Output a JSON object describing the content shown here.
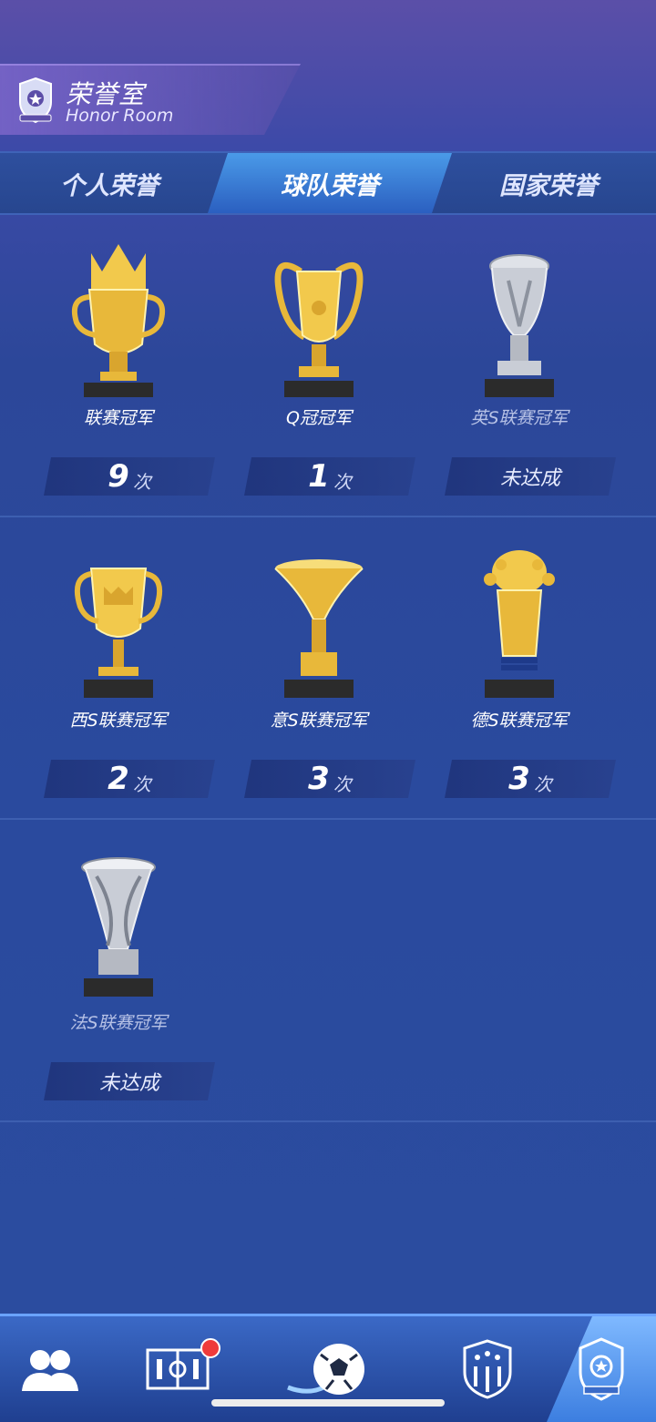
{
  "header": {
    "title_cn": "荣誉室",
    "title_en": "Honor Room"
  },
  "tabs": [
    {
      "label": "个人荣誉",
      "active": false
    },
    {
      "label": "球队荣誉",
      "active": true
    },
    {
      "label": "国家荣誉",
      "active": false
    }
  ],
  "trophies": [
    {
      "name": "联赛冠军",
      "count": "9",
      "unit": "次",
      "achieved": true,
      "color": "#e8b83a"
    },
    {
      "name": "Q冠冠军",
      "count": "1",
      "unit": "次",
      "achieved": true,
      "color": "#e8b83a"
    },
    {
      "name": "英S联赛冠军",
      "status": "未达成",
      "achieved": false,
      "color": "#c9cdd6"
    },
    {
      "name": "西S联赛冠军",
      "count": "2",
      "unit": "次",
      "achieved": true,
      "color": "#e8b83a"
    },
    {
      "name": "意S联赛冠军",
      "count": "3",
      "unit": "次",
      "achieved": true,
      "color": "#e8b83a"
    },
    {
      "name": "德S联赛冠军",
      "count": "3",
      "unit": "次",
      "achieved": true,
      "color": "#e8b83a"
    },
    {
      "name": "法S联赛冠军",
      "status": "未达成",
      "achieved": false,
      "color": "#c9cdd6"
    }
  ],
  "nav": [
    {
      "icon": "team-icon"
    },
    {
      "icon": "formation-icon",
      "badge": true
    },
    {
      "icon": "football-icon"
    },
    {
      "icon": "club-shield-icon"
    },
    {
      "icon": "trophy-emblem-icon",
      "active": true
    }
  ]
}
